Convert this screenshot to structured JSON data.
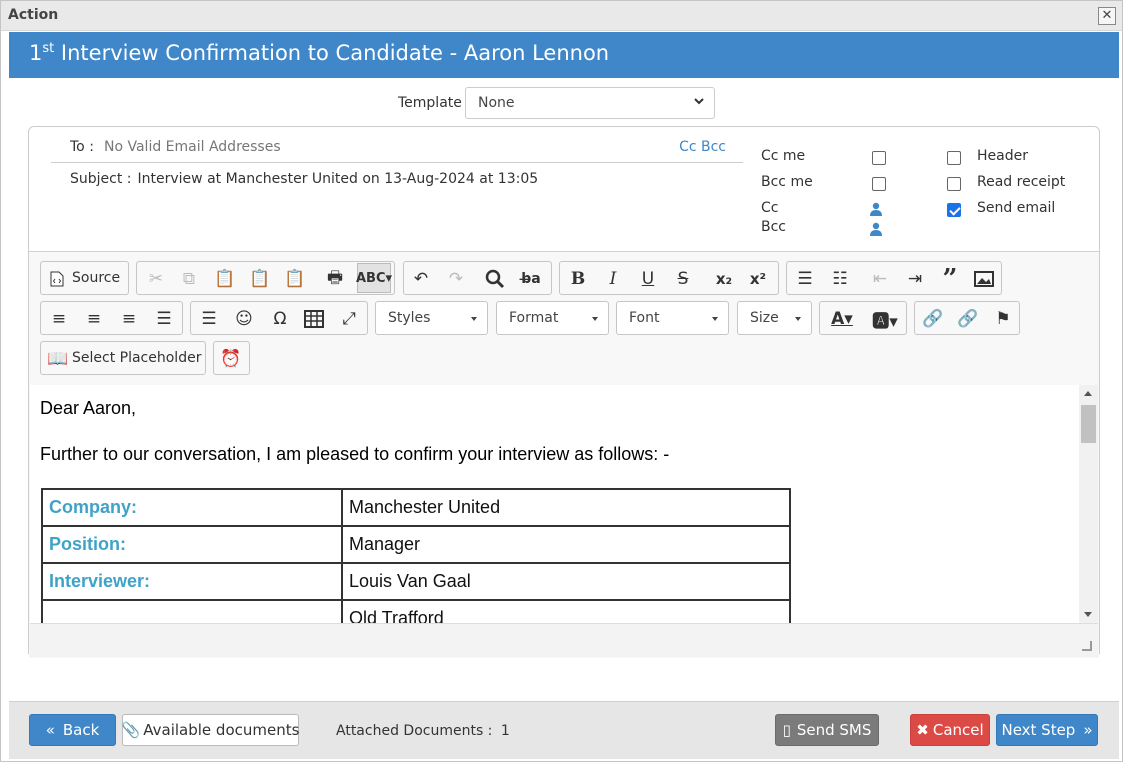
{
  "window": {
    "title": "Action",
    "close_label": "✕"
  },
  "header": {
    "title_sup": "st",
    "title_num": "1",
    "title_rest": " Interview Confirmation to Candidate - Aaron Lennon"
  },
  "template": {
    "label": "Template",
    "value": "None"
  },
  "email": {
    "to_label": "To :",
    "to_value": "No Valid Email Addresses",
    "cc_bcc_link": "Cc Bcc",
    "subject_label": "Subject :",
    "subject_value": "Interview at Manchester United on 13-Aug-2024 at 13:05"
  },
  "options": {
    "cc_me": {
      "label": "Cc me",
      "checked": false
    },
    "bcc_me": {
      "label": "Bcc me",
      "checked": false
    },
    "cc": {
      "label": "Cc"
    },
    "bcc": {
      "label": "Bcc"
    },
    "header": {
      "label": "Header",
      "checked": false
    },
    "read_receipt": {
      "label": "Read receipt",
      "checked": false
    },
    "send_email": {
      "label": "Send email",
      "checked": true
    }
  },
  "toolbar": {
    "source": "Source",
    "styles": "Styles",
    "format": "Format",
    "font": "Font",
    "size": "Size",
    "select_placeholder": "Select Placeholder"
  },
  "body": {
    "greeting": "Dear Aaron,",
    "intro": "Further to our conversation, I am pleased to confirm your interview as follows: -",
    "rows": [
      {
        "key": "Company:",
        "value": "Manchester United"
      },
      {
        "key": "Position:",
        "value": "Manager"
      },
      {
        "key": "Interviewer:",
        "value": "Louis Van Gaal"
      },
      {
        "key": "",
        "value": "Old Trafford"
      }
    ]
  },
  "footer": {
    "back": "Back",
    "available_documents": "Available documents",
    "attached_label": "Attached Documents :",
    "attached_count": "1",
    "send_sms": "Send SMS",
    "cancel": "Cancel",
    "next_step": "Next Step"
  },
  "colors": {
    "brand": "#3f87c9",
    "label_teal": "#3fa3c7",
    "cancel_red": "#dc4a46",
    "sms_grey": "#7b7b7b"
  }
}
